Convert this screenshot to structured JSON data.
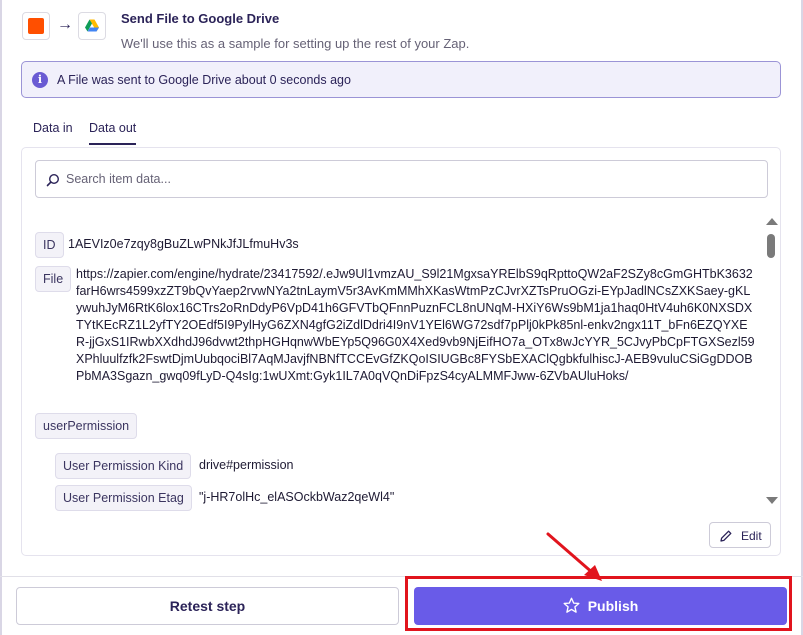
{
  "header": {
    "title": "Send File to Google Drive",
    "subtitle": "We'll use this as a sample for setting up the rest of your Zap.",
    "source_app_color": "#ff4f00"
  },
  "banner": {
    "icon": "info-icon",
    "icon_glyph": "i",
    "text": "A File was sent to Google Drive about 0 seconds ago"
  },
  "tabs": [
    {
      "label": "Data in",
      "active": false
    },
    {
      "label": "Data out",
      "active": true
    }
  ],
  "search": {
    "placeholder": "Search item data..."
  },
  "data_items": {
    "id": {
      "key": "ID",
      "value": "1AEVIz0e7zqy8gBuZLwPNkJfJLfmuHv3s"
    },
    "file": {
      "key": "File",
      "value": "https://zapier.com/engine/hydrate/23417592/.eJw9Ul1vmzAU_S9l21MgxsaYRElbS9qRpttoQW2aF2SZy8cGmGHTbK3632farH6wrs4599xzZT9bQvYaep2rvwNYa2tnLaymV5r3AvKmMMhXKasWtmPzCJvrXZTsPruOGzi-EYpJadlNCsZXKSaey-gKLywuhJyM6RtK6lox16CTrs2oRnDdyP6VpD41h6GFVTbQFnnPuznFCL8nUNqM-HXiY6Ws9bM1ja1haq0HtV4uh6K0NXSDXTYtKEcRZ1L2yfTY2OEdf5I9PylHyG6ZXN4gfG2iZdlDdri4I9nV1YEl6WG72sdf7pPlj0kPk85nl-enkv2ngx11T_bFn6EZQYXER-jjGxS1IRwbXXdhdJ96dvwt2thpHGHqnwWbEYp5Q96G0X4Xed9vb9NjEifHO7a_OTx8wJcYYR_5CJvyPbCpFTGXSezl59XPhluulfzfk2FswtDjmUubqociBl7AqMJavjfNBNfTCCEvGfZKQoISIUGBc8FYSbEXAClQgbkfulhiscJ-AEB9vuluCSiGgDDOBPbMA3Sgazn_gwq09fLyD-Q4sIg:1wUXmt:Gyk1IL7A0qVQnDiFpzS4cyALMMFJww-6ZVbAUluHoks/"
    },
    "user_permission": {
      "key": "userPermission"
    },
    "user_permission_kind": {
      "key": "User Permission Kind",
      "value": "drive#permission"
    },
    "user_permission_etag": {
      "key": "User Permission Etag",
      "value": "\"j-HR7olHc_elASOckbWaz2qeWl4\""
    }
  },
  "edit_label": "Edit",
  "footer": {
    "retest_label": "Retest step",
    "publish_label": "Publish"
  },
  "colors": {
    "accent": "#695be8",
    "annotation": "#e1141d",
    "banner_border": "#9b94d6"
  }
}
